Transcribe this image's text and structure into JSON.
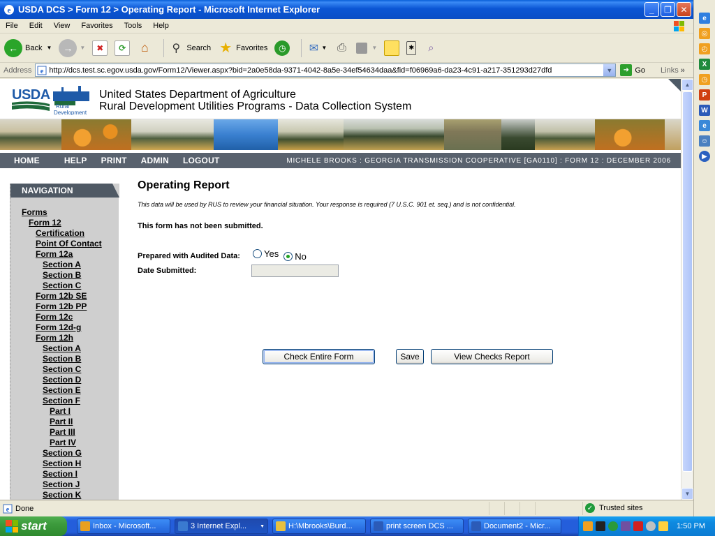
{
  "window": {
    "title": "USDA DCS > Form 12 > Operating Report - Microsoft Internet Explorer"
  },
  "menu": [
    "File",
    "Edit",
    "View",
    "Favorites",
    "Tools",
    "Help"
  ],
  "toolbar": {
    "back_label": "Back",
    "search_label": "Search",
    "favorites_label": "Favorites"
  },
  "address": {
    "label": "Address",
    "url": "http://dcs.test.sc.egov.usda.gov/Form12/Viewer.aspx?bid=2a0e58da-9371-4042-8a5e-34ef54634daa&fid=f06969a6-da23-4c91-a217-351293d27dfd",
    "go_label": "Go",
    "links_label": "Links"
  },
  "site": {
    "logo_text": "USDA",
    "logo_sub1": "Rural",
    "logo_sub2": "Development",
    "title_line1": "United States Department of Agriculture",
    "title_line2": "Rural Development Utilities Programs - Data Collection System",
    "nav": [
      "HOME",
      "HELP",
      "PRINT",
      "ADMIN",
      "LOGOUT"
    ],
    "user_info": "MICHELE BROOKS : GEORGIA TRANSMISSION COOPERATIVE [GA0110] : FORM 12 : DECEMBER 2006"
  },
  "navigation": {
    "header": "NAVIGATION",
    "items": [
      {
        "label": "Forms",
        "level": 0
      },
      {
        "label": "Form 12",
        "level": 1
      },
      {
        "label": "Certification",
        "level": 2
      },
      {
        "label": "Point Of Contact",
        "level": 2
      },
      {
        "label": "Form 12a",
        "level": 2
      },
      {
        "label": "Section A",
        "level": 3
      },
      {
        "label": "Section B",
        "level": 3
      },
      {
        "label": "Section C",
        "level": 3
      },
      {
        "label": "Form 12b SE",
        "level": 2
      },
      {
        "label": "Form 12b PP",
        "level": 2
      },
      {
        "label": "Form 12c",
        "level": 2
      },
      {
        "label": "Form 12d-g",
        "level": 2
      },
      {
        "label": "Form 12h",
        "level": 2
      },
      {
        "label": "Section A",
        "level": 3
      },
      {
        "label": "Section B",
        "level": 3
      },
      {
        "label": "Section C",
        "level": 3
      },
      {
        "label": "Section D",
        "level": 3
      },
      {
        "label": "Section E",
        "level": 3
      },
      {
        "label": "Section F",
        "level": 3
      },
      {
        "label": "Part I",
        "level": 4
      },
      {
        "label": "Part II",
        "level": 4
      },
      {
        "label": "Part III",
        "level": 4
      },
      {
        "label": "Part IV",
        "level": 4
      },
      {
        "label": "Section G",
        "level": 3
      },
      {
        "label": "Section H",
        "level": 3
      },
      {
        "label": "Section I",
        "level": 3
      },
      {
        "label": "Section J",
        "level": 3
      },
      {
        "label": "Section K",
        "level": 3
      }
    ]
  },
  "form": {
    "title": "Operating Report",
    "notice": "This data will be used by RUS to review your financial situation. Your response is required (7 U.S.C. 901 et. seq.) and is not confidential.",
    "status": "This form has not been submitted.",
    "audited_label": "Prepared with Audited Data:",
    "audited_yes": "Yes",
    "audited_no": "No",
    "audited_selected": "No",
    "date_label": "Date Submitted:",
    "date_value": "",
    "check_button": "Check Entire Form",
    "save_button": "Save",
    "view_checks_button": "View Checks Report"
  },
  "statusbar": {
    "status": "Done",
    "zone": "Trusted sites"
  },
  "taskbar": {
    "start": "start",
    "tasks": [
      {
        "label": "Inbox - Microsoft...",
        "color": "#e8a020"
      },
      {
        "label": "3 Internet Expl...",
        "color": "#3a7ad0",
        "active": true
      },
      {
        "label": "H:\\Mbrooks\\Burd...",
        "color": "#e8c040"
      },
      {
        "label": "print screen DCS ...",
        "color": "#2b5bb8"
      },
      {
        "label": "Document2 - Micr...",
        "color": "#2b5bb8"
      }
    ],
    "clock": "1:50 PM"
  },
  "colors": {
    "nav_bar": "#59626e",
    "leftnav_bg": "#cfcfcf",
    "title_bar": "#0b56d5"
  }
}
